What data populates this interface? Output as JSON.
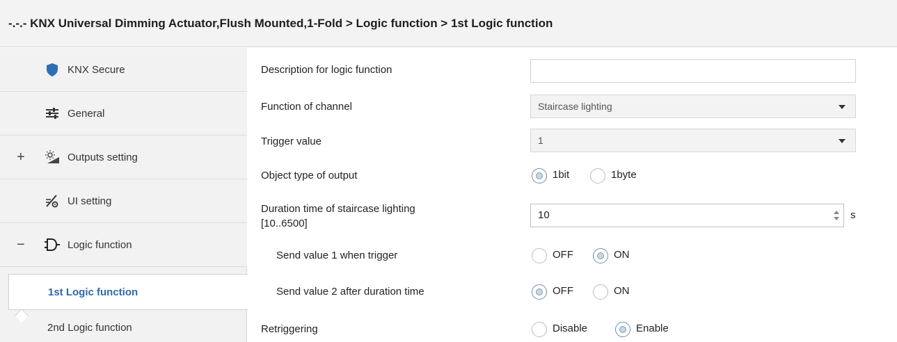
{
  "title": "-.-.- KNX Universal Dimming Actuator,Flush Mounted,1-Fold > Logic function > 1st Logic function",
  "sidebar": {
    "items": [
      {
        "label": "KNX Secure",
        "icon": "shield-icon",
        "expander": ""
      },
      {
        "label": "General",
        "icon": "sliders-icon",
        "expander": ""
      },
      {
        "label": "Outputs setting",
        "icon": "dimmer-lamp-icon",
        "expander": "+"
      },
      {
        "label": "UI setting",
        "icon": "ui-settings-icon",
        "expander": ""
      },
      {
        "label": "Logic function",
        "icon": "logic-gate-icon",
        "expander": "−"
      }
    ],
    "subitems": [
      {
        "label": "1st Logic function",
        "selected": true
      },
      {
        "label": "2nd Logic function",
        "selected": false
      }
    ]
  },
  "params": {
    "description": {
      "label": "Description for logic function",
      "value": ""
    },
    "function": {
      "label": "Function of channel",
      "value": "Staircase lighting"
    },
    "trigger": {
      "label": "Trigger value",
      "value": "1"
    },
    "object_type": {
      "label": "Object type of  output",
      "options": [
        "1bit",
        "1byte"
      ],
      "selected": "1bit"
    },
    "duration": {
      "label_line1": "Duration time of staircase lighting",
      "label_line2": "[10..6500]",
      "value": "10",
      "unit": "s"
    },
    "send1": {
      "label": "Send value 1 when trigger",
      "options": [
        "OFF",
        "ON"
      ],
      "selected": "ON"
    },
    "send2": {
      "label": "Send value 2 after duration time",
      "options": [
        "OFF",
        "ON"
      ],
      "selected": "OFF"
    },
    "retrigger": {
      "label": "Retriggering",
      "options": [
        "Disable",
        "Enable"
      ],
      "selected": "Enable"
    }
  },
  "colors": {
    "accent": "#2d6aa8",
    "shield": "#2f6db5"
  }
}
